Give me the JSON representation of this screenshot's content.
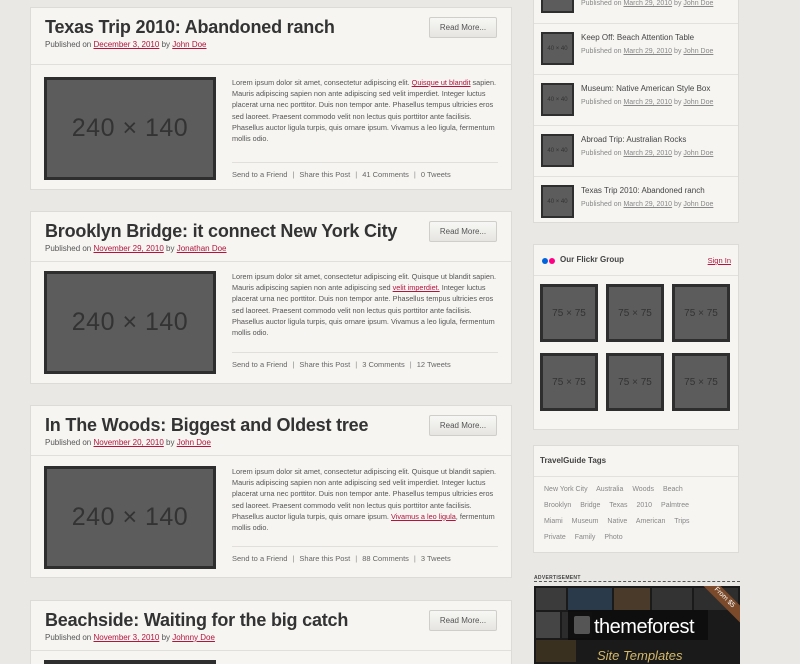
{
  "posts": [
    {
      "title": "Texas Trip 2010: Abandoned ranch",
      "published_prefix": "Published on",
      "date": "December 3, 2010",
      "by": "by",
      "author": "John Doe",
      "read_more": "Read More...",
      "thumb": "240 × 140",
      "excerpt_a": "Lorem ipsum dolor sit amet, consectetur adipiscing elit.",
      "excerpt_link": "Quisque ut blandit",
      "excerpt_b": "sapien. Mauris adipiscing sapien non ante adipiscing sed velit imperdiet. Integer luctus placerat urna nec porttitor. Duis non tempor ante. Phasellus tempus ultricies eros sed laoreet. Praesent commodo velit non lectus quis porttitor ante facilisis. Phasellus auctor ligula turpis, quis ornare ipsum. Vivamus a leo ligula, fermentum mollis odio.",
      "excerpt_c": "",
      "send": "Send to a Friend",
      "share": "Share this Post",
      "comments": "41 Comments",
      "tweets": "0 Tweets"
    },
    {
      "title": "Brooklyn Bridge: it connect New York City",
      "published_prefix": "Published on",
      "date": "November 29, 2010",
      "by": "by",
      "author": "Jonathan Doe",
      "read_more": "Read More...",
      "thumb": "240 × 140",
      "excerpt_a": "Lorem ipsum dolor sit amet, consectetur adipiscing elit. Quisque ut blandit sapien. Mauris adipiscing sapien non ante adipiscing sed",
      "excerpt_link": "velit imperdiet.",
      "excerpt_b": "Integer luctus placerat urna nec porttitor. Duis non tempor ante. Phasellus tempus ultricies eros sed laoreet. Praesent commodo velit non lectus quis porttitor ante facilisis. Phasellus auctor ligula turpis, quis ornare ipsum. Vivamus a leo ligula, fermentum mollis odio.",
      "excerpt_c": "",
      "send": "Send to a Friend",
      "share": "Share this Post",
      "comments": "3 Comments",
      "tweets": "12 Tweets"
    },
    {
      "title": "In The Woods: Biggest and Oldest tree",
      "published_prefix": "Published on",
      "date": "November 20, 2010",
      "by": "by",
      "author": "John Doe",
      "read_more": "Read More...",
      "thumb": "240 × 140",
      "excerpt_a": "Lorem ipsum dolor sit amet, consectetur adipiscing elit. Quisque ut blandit sapien. Mauris adipiscing sapien non ante adipiscing sed velit imperdiet. Integer luctus placerat urna nec porttitor. Duis non tempor ante. Phasellus tempus ultricies eros sed laoreet. Praesent commodo velit non lectus quis porttitor ante facilisis. Phasellus auctor ligula turpis, quis ornare ipsum.",
      "excerpt_link": "Vivamus a leo ligula",
      "excerpt_b": "",
      "excerpt_c": ", fermentum mollis odio.",
      "send": "Send to a Friend",
      "share": "Share this Post",
      "comments": "88 Comments",
      "tweets": "3 Tweets"
    },
    {
      "title": "Beachside: Waiting for the big catch",
      "published_prefix": "Published on",
      "date": "November 3, 2010",
      "by": "by",
      "author": "Johnny Doe",
      "read_more": "Read More..."
    }
  ],
  "recent": {
    "thumb": "40 × 40",
    "published_prefix": "Published on",
    "by": "by",
    "items": [
      {
        "title": "",
        "date": "March 29, 2010",
        "author": "John Doe"
      },
      {
        "title": "Keep Off: Beach Attention Table",
        "date": "March 29, 2010",
        "author": "John Doe"
      },
      {
        "title": "Museum: Native American Style Box",
        "date": "March 29, 2010",
        "author": "John Doe"
      },
      {
        "title": "Abroad Trip: Australian Rocks",
        "date": "March 29, 2010",
        "author": "John Doe"
      },
      {
        "title": "Texas Trip 2010: Abandoned ranch",
        "date": "March 29, 2010",
        "author": "John Doe"
      }
    ]
  },
  "flickr": {
    "title": "Our Flickr Group",
    "signin": "Sign In",
    "thumb": "75 × 75",
    "dot_colors": [
      "#0063dc",
      "#ff0084"
    ]
  },
  "tags": {
    "title": "TravelGuide Tags",
    "items": [
      "New York City",
      "Australia",
      "Woods",
      "Beach",
      "Brooklyn",
      "Bridge",
      "Texas",
      "2010",
      "Palmtree",
      "Miami",
      "Museum",
      "Native",
      "American",
      "Trips",
      "Private",
      "Family",
      "Photo"
    ]
  },
  "ad": {
    "label": "ADVERTISEMENT",
    "brand": "themeforest",
    "sub": "Site Templates",
    "ribbon": "From $5"
  },
  "colors": {
    "accent": "#b3143c",
    "background": "#e9e8e5",
    "panel": "#f6f5f2"
  }
}
